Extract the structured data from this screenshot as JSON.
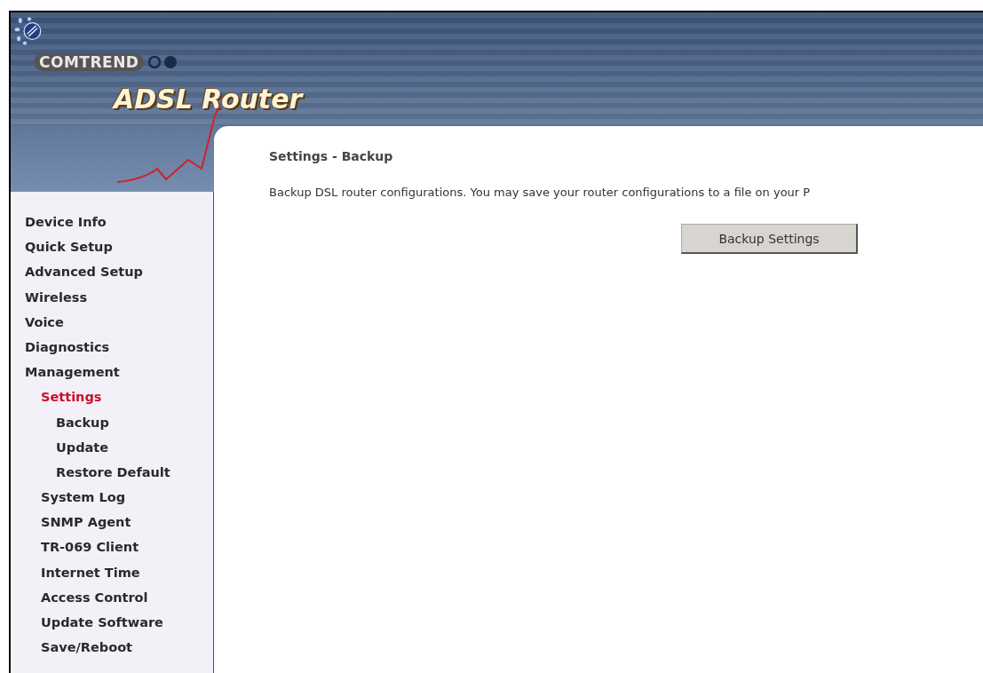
{
  "header": {
    "brand": "COMTREND",
    "product": "ADSL Router"
  },
  "sidebar": {
    "items": [
      {
        "label": "Device Info",
        "selected": false
      },
      {
        "label": "Quick Setup",
        "selected": false
      },
      {
        "label": "Advanced Setup",
        "selected": false
      },
      {
        "label": "Wireless",
        "selected": false
      },
      {
        "label": "Voice",
        "selected": false
      },
      {
        "label": "Diagnostics",
        "selected": false
      },
      {
        "label": "Management",
        "selected": false,
        "children": [
          {
            "label": "Settings",
            "selected": true,
            "children": [
              {
                "label": "Backup",
                "selected": false
              },
              {
                "label": "Update",
                "selected": false
              },
              {
                "label": "Restore Default",
                "selected": false
              }
            ]
          },
          {
            "label": "System Log",
            "selected": false
          },
          {
            "label": "SNMP Agent",
            "selected": false
          },
          {
            "label": "TR-069 Client",
            "selected": false
          },
          {
            "label": "Internet Time",
            "selected": false
          },
          {
            "label": "Access Control",
            "selected": false
          },
          {
            "label": "Update Software",
            "selected": false
          },
          {
            "label": "Save/Reboot",
            "selected": false
          }
        ]
      }
    ]
  },
  "content": {
    "title": "Settings - Backup",
    "description": "Backup DSL router configurations. You may save your router configurations to a file on your P",
    "button": "Backup Settings"
  }
}
